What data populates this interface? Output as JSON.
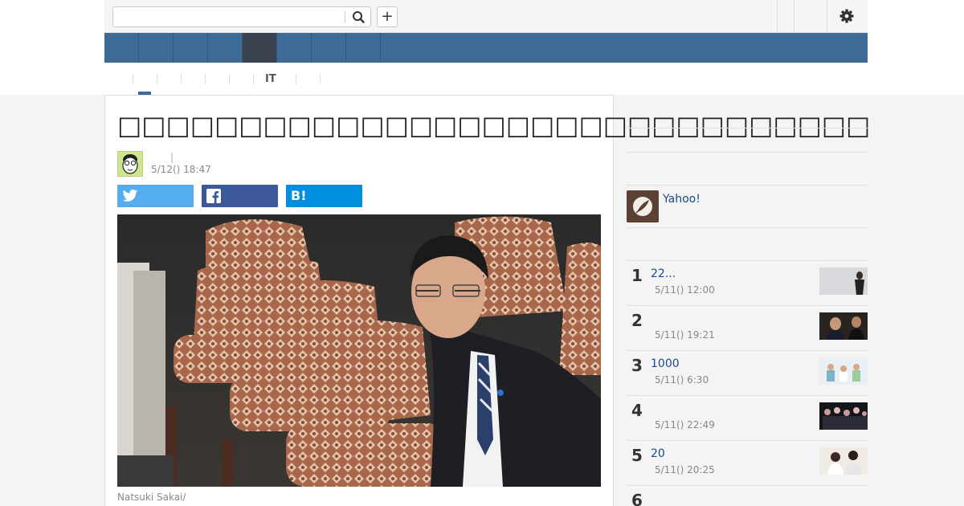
{
  "header": {
    "search_placeholder": "",
    "add_label": "+"
  },
  "nav": {
    "tabs": [
      {
        "label": ""
      },
      {
        "label": ""
      },
      {
        "label": ""
      },
      {
        "label": ""
      },
      {
        "label": "",
        "active": true
      },
      {
        "label": ""
      },
      {
        "label": ""
      },
      {
        "label": ""
      },
      {
        "label": ""
      }
    ]
  },
  "subnav": {
    "items": [
      "",
      "",
      "",
      "",
      "",
      "",
      "IT",
      "",
      ""
    ]
  },
  "article": {
    "title": "□□□□□□□□□□□□□□□□□□□□□□□□□□□□□□□",
    "author_separator": "|",
    "date": "5/12() 18:47",
    "share": {
      "twitter": "",
      "facebook": "",
      "hatena": "B!"
    },
    "caption": "Natsuki Sakai/"
  },
  "sidebar": {
    "yahoo_label": "Yahoo!",
    "ranking": [
      {
        "num": "1",
        "title": "22...",
        "time": "5/11() 12:00"
      },
      {
        "num": "2",
        "title": "",
        "time": "5/11() 19:21"
      },
      {
        "num": "3",
        "title": "1000",
        "time": "5/11() 6:30"
      },
      {
        "num": "4",
        "title": "",
        "time": "5/11() 22:49"
      },
      {
        "num": "5",
        "title": "20",
        "time": "5/11() 20:25"
      },
      {
        "num": "6",
        "title": "",
        "time": ""
      }
    ]
  },
  "colors": {
    "nav_bg": "#3e6a96",
    "nav_active": "#3c4350",
    "twitter": "#55acee",
    "facebook": "#3b5998",
    "hatena": "#008fde",
    "link": "#1a4a8a"
  }
}
